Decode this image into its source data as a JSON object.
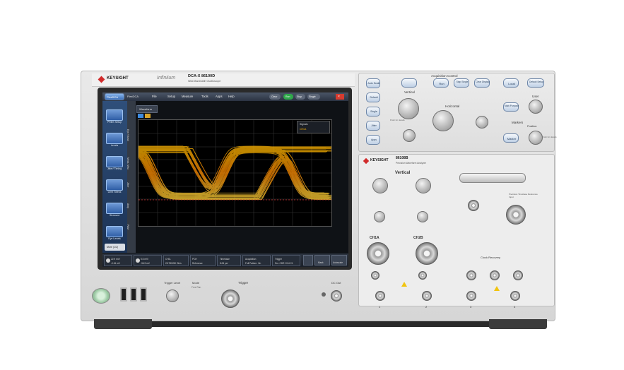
{
  "brand": {
    "logo": "KEYSIGHT",
    "series": "Infiniium",
    "model": "DCA-X 86100D",
    "tagline": "Wide-Bandwidth Oscilloscope"
  },
  "screen": {
    "app_button": "FlexDCA",
    "app_title": "FlexDCA",
    "menu": [
      "File",
      "Setup",
      "Measure",
      "Tools",
      "Apps",
      "Help"
    ],
    "top_buttons": [
      "Clear",
      "Run",
      "Stop",
      "Single"
    ],
    "tab": "Waveform",
    "sidebar": [
      "PRBS Setup",
      "Levels",
      "Jitter/ Timing",
      "Limit Stress",
      "Stressed",
      "Eye Levels"
    ],
    "vertical_tabs": [
      "Eye / Mask",
      "Meas. Misc",
      "Jitter",
      "Amp",
      "PAM"
    ],
    "more_button": "More (1/2)",
    "legend": [
      "Signals",
      "CH1A"
    ],
    "status": [
      {
        "title": "22.9 mV/",
        "sub": "-0.61 mV"
      },
      {
        "title": "5.6 mV/",
        "sub": "-36.9 mV"
      },
      {
        "title": "CHD-",
        "sub": "25.781250 Gb/s"
      },
      {
        "title": "PCH",
        "sub": "Reference"
      },
      {
        "title": "Timebase",
        "sub": "8.06 ps/"
      },
      {
        "title": "Acquisition",
        "sub": "Full Pattern: On"
      },
      {
        "title": "Trigger",
        "sub": "Src: CDR CH4 C1"
      }
    ],
    "status_buttons": [
      "Mask",
      "Autoscale"
    ]
  },
  "frontpanel": {
    "acquisition_label": "Acquisition Control",
    "buttons_left": [
      "Auto Scale",
      "Default",
      "Single",
      "Jitter",
      "Apps"
    ],
    "buttons_acq": [
      "Run",
      "Stop Single",
      "Clear Display"
    ],
    "buttons_right": [
      "Local",
      "Default Setup"
    ],
    "vertical_label": "Vertical",
    "horizontal_label": "Horizontal",
    "marker_label": "Markers",
    "multi_purpose": "Multi Purpose",
    "marker_btn": "Marker",
    "user_label": "User",
    "position_label": "Position",
    "push_label": "Push for details"
  },
  "module": {
    "logo": "KEYSIGHT",
    "model": "86108B",
    "description": "Precision Waveform Analyzer",
    "vertical_label": "Vertical",
    "ch1": "CH1A",
    "ch2": "CH2B",
    "cdr": "Clock Recovery",
    "reference": "Precision Timebase Reference Input",
    "ports": [
      "1",
      "2",
      "3",
      "4"
    ]
  },
  "bottom": {
    "trigger_level": "Trigger Level",
    "mode": "Mode",
    "trigger": "Trigger",
    "dc_out": "DC Out",
    "free_run": "Free Run"
  }
}
